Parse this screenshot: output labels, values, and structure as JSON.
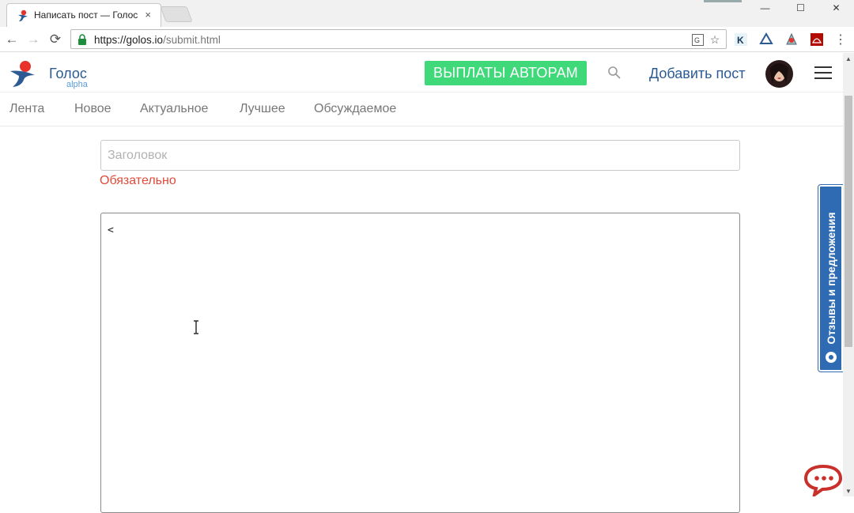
{
  "browser": {
    "tab_title": "Написать пост — Голос",
    "tab_close": "×",
    "url_scheme_host": "https://golos.io",
    "url_path": "/submit.html",
    "window_minimize": "—",
    "window_maximize": "☐",
    "window_close": "✕"
  },
  "header": {
    "brand": "Голос",
    "brand_sub": "alpha",
    "payout_button": "ВЫПЛАТЫ АВТОРАМ",
    "add_post": "Добавить пост"
  },
  "subnav": {
    "items": [
      "Лента",
      "Новое",
      "Актуальное",
      "Лучшее",
      "Обсуждаемое"
    ]
  },
  "form": {
    "title_placeholder": "Заголовок",
    "title_value": "",
    "required_msg": "Обязательно",
    "body_value": "<"
  },
  "feedback": {
    "label": "Отзывы и предложения"
  },
  "colors": {
    "accent_green": "#3fd979",
    "brand_blue": "#2c5a92",
    "error_red": "#e04a3b",
    "feedback_blue": "#2e6bb3"
  },
  "icons": {
    "back": "←",
    "forward": "→",
    "reload": "⟳",
    "star": "☆",
    "scroll_up": "▲",
    "scroll_down": "▼"
  }
}
